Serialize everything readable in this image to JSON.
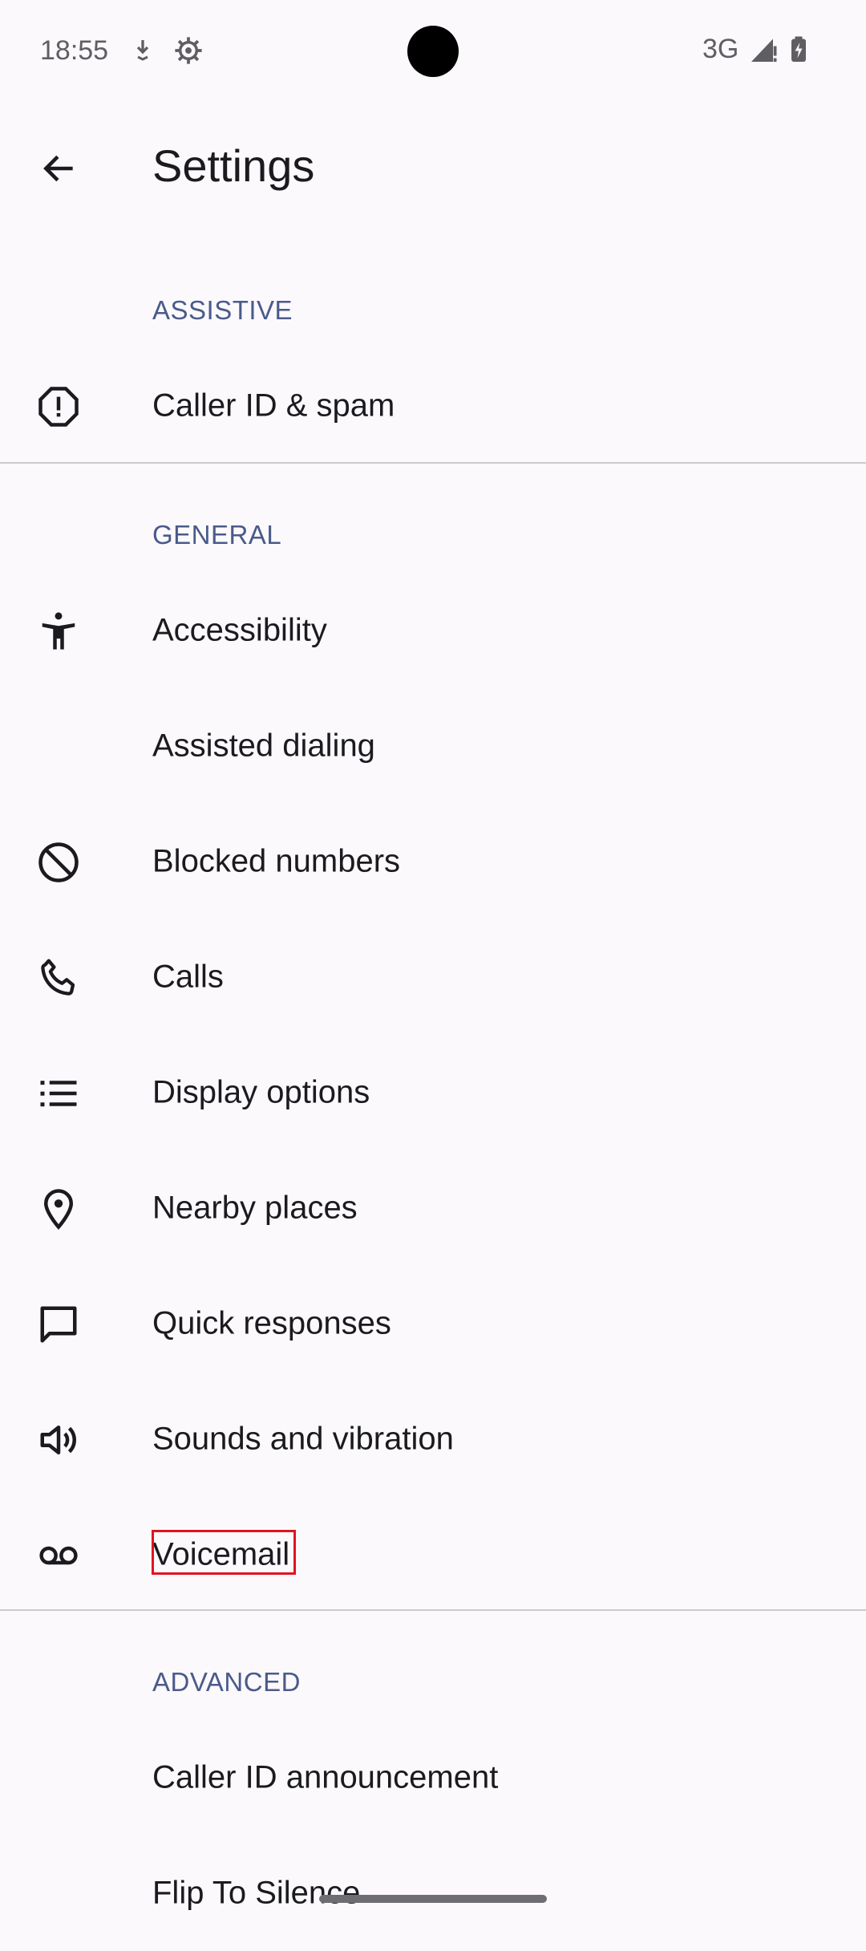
{
  "status_bar": {
    "time": "18:55",
    "network": "3G",
    "icons": [
      "download-icon",
      "settings-gear-icon",
      "signal-icon",
      "battery-icon"
    ]
  },
  "app_bar": {
    "title": "Settings",
    "back_icon": "arrow-back-icon"
  },
  "sections": {
    "assistive": {
      "header": "ASSISTIVE",
      "items": [
        {
          "label": "Caller ID & spam",
          "icon": "alert-octagon-icon"
        }
      ]
    },
    "general": {
      "header": "GENERAL",
      "items": [
        {
          "label": "Accessibility",
          "icon": "accessibility-icon"
        },
        {
          "label": "Assisted dialing",
          "icon": ""
        },
        {
          "label": "Blocked numbers",
          "icon": "block-icon"
        },
        {
          "label": "Calls",
          "icon": "phone-icon"
        },
        {
          "label": "Display options",
          "icon": "list-icon"
        },
        {
          "label": "Nearby places",
          "icon": "location-pin-icon"
        },
        {
          "label": "Quick responses",
          "icon": "chat-bubble-icon"
        },
        {
          "label": "Sounds and vibration",
          "icon": "volume-icon"
        },
        {
          "label": "Voicemail",
          "icon": "voicemail-icon"
        }
      ]
    },
    "advanced": {
      "header": "ADVANCED",
      "items": [
        {
          "label": "Caller ID announcement",
          "icon": ""
        },
        {
          "label": "Flip To Silence",
          "icon": ""
        }
      ]
    }
  },
  "colors": {
    "background": "#fcf9fd",
    "section_header": "#4a5b8a",
    "text": "#1b1b1f",
    "highlight": "#e0141e"
  }
}
